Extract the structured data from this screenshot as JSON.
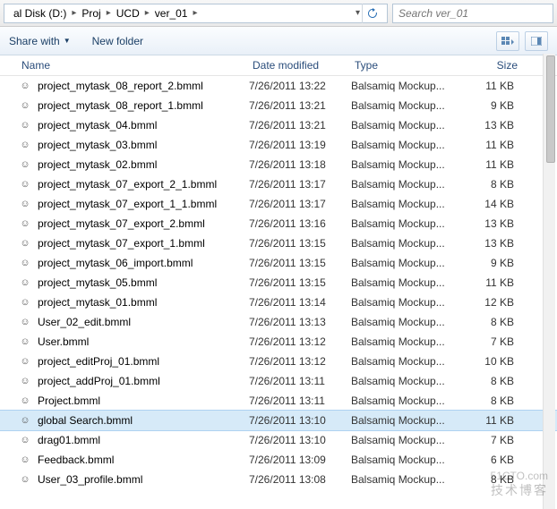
{
  "breadcrumb": [
    "al Disk (D:)",
    "Proj",
    "UCD",
    "ver_01"
  ],
  "search": {
    "placeholder": "Search ver_01"
  },
  "toolbar": {
    "share": "Share with",
    "newfolder": "New folder"
  },
  "columns": {
    "name": "Name",
    "date": "Date modified",
    "type": "Type",
    "size": "Size"
  },
  "type_label": "Balsamiq Mockup...",
  "selected_index": 17,
  "files": [
    {
      "name": "project_mytask_08_report_2.bmml",
      "date": "7/26/2011 13:22",
      "size": "11 KB"
    },
    {
      "name": "project_mytask_08_report_1.bmml",
      "date": "7/26/2011 13:21",
      "size": "9 KB"
    },
    {
      "name": "project_mytask_04.bmml",
      "date": "7/26/2011 13:21",
      "size": "13 KB"
    },
    {
      "name": "project_mytask_03.bmml",
      "date": "7/26/2011 13:19",
      "size": "11 KB"
    },
    {
      "name": "project_mytask_02.bmml",
      "date": "7/26/2011 13:18",
      "size": "11 KB"
    },
    {
      "name": "project_mytask_07_export_2_1.bmml",
      "date": "7/26/2011 13:17",
      "size": "8 KB"
    },
    {
      "name": "project_mytask_07_export_1_1.bmml",
      "date": "7/26/2011 13:17",
      "size": "14 KB"
    },
    {
      "name": "project_mytask_07_export_2.bmml",
      "date": "7/26/2011 13:16",
      "size": "13 KB"
    },
    {
      "name": "project_mytask_07_export_1.bmml",
      "date": "7/26/2011 13:15",
      "size": "13 KB"
    },
    {
      "name": "project_mytask_06_import.bmml",
      "date": "7/26/2011 13:15",
      "size": "9 KB"
    },
    {
      "name": "project_mytask_05.bmml",
      "date": "7/26/2011 13:15",
      "size": "11 KB"
    },
    {
      "name": "project_mytask_01.bmml",
      "date": "7/26/2011 13:14",
      "size": "12 KB"
    },
    {
      "name": "User_02_edit.bmml",
      "date": "7/26/2011 13:13",
      "size": "8 KB"
    },
    {
      "name": "User.bmml",
      "date": "7/26/2011 13:12",
      "size": "7 KB"
    },
    {
      "name": "project_editProj_01.bmml",
      "date": "7/26/2011 13:12",
      "size": "10 KB"
    },
    {
      "name": "project_addProj_01.bmml",
      "date": "7/26/2011 13:11",
      "size": "8 KB"
    },
    {
      "name": "Project.bmml",
      "date": "7/26/2011 13:11",
      "size": "8 KB"
    },
    {
      "name": "global Search.bmml",
      "date": "7/26/2011 13:10",
      "size": "11 KB"
    },
    {
      "name": "drag01.bmml",
      "date": "7/26/2011 13:10",
      "size": "7 KB"
    },
    {
      "name": "Feedback.bmml",
      "date": "7/26/2011 13:09",
      "size": "6 KB"
    },
    {
      "name": "User_03_profile.bmml",
      "date": "7/26/2011 13:08",
      "size": "8 KB"
    }
  ],
  "watermark": {
    "main": "51CTO.com",
    "sub": "技术博客"
  }
}
